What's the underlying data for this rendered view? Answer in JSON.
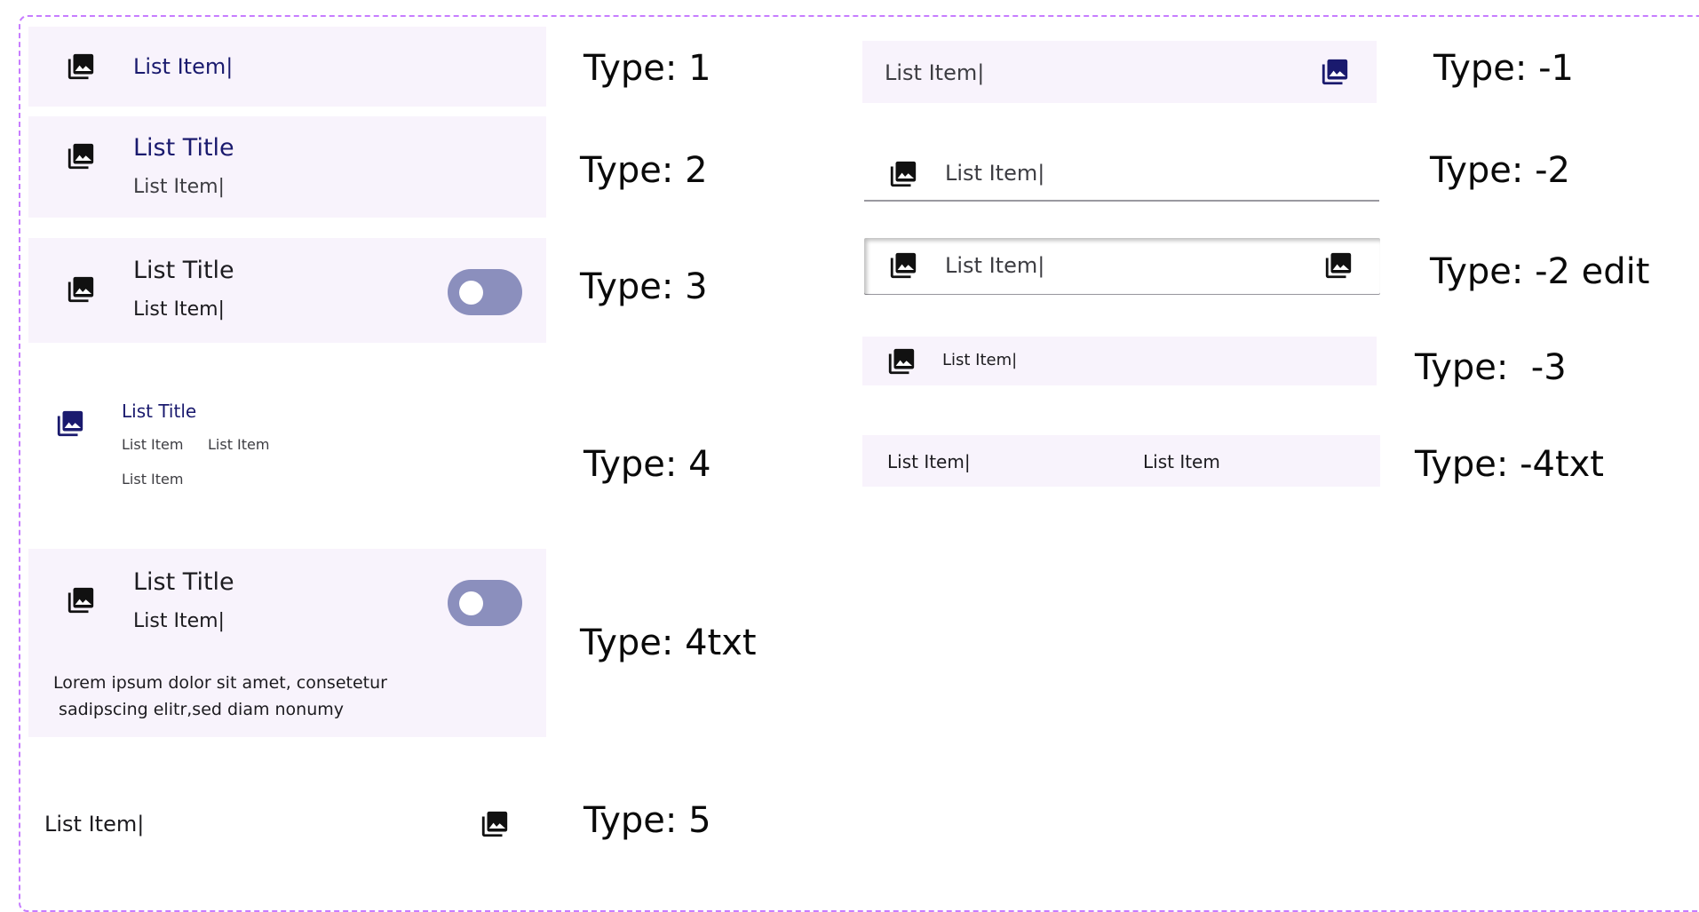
{
  "icon_name": "photo-library-icon",
  "colors": {
    "card_bg": "#f8f3fc",
    "accent_navy": "#1a1a6e",
    "toggle_track": "#8b8fbd",
    "frame_border": "#c77dff"
  },
  "left": {
    "t1": {
      "item": "List Item|"
    },
    "t2": {
      "title": "List Title",
      "item": "List Item|"
    },
    "t3": {
      "title": "List Title",
      "item": "List Item|",
      "toggle_on": false
    },
    "t4": {
      "title": "List Title",
      "items": [
        "List Item",
        "List Item",
        "List Item"
      ]
    },
    "t4txt": {
      "title": "List Title",
      "item": "List Item|",
      "toggle_on": false,
      "body_line1": "Lorem ipsum dolor sit amet, consetetur",
      "body_line2": " sadipscing elitr,sed diam nonumy"
    },
    "t5": {
      "item": "List Item|"
    }
  },
  "right": {
    "m1": {
      "item": "List Item|"
    },
    "m2": {
      "item": "List Item|"
    },
    "m2edit": {
      "item": "List Item|"
    },
    "m3": {
      "item": "List Item|"
    },
    "m4txt": {
      "item": "List Item|",
      "item2": "List Item"
    }
  },
  "labels": {
    "type1": "Type: 1",
    "type2": "Type: 2",
    "type3": "Type: 3",
    "type4": "Type: 4",
    "type4txt": "Type: 4txt",
    "type5": "Type: 5",
    "typem1": "Type: -1",
    "typem2": "Type: -2",
    "typem2edit": "Type: -2 edit",
    "typem3": "Type:  -3",
    "typem4txt": "Type: -4txt"
  }
}
